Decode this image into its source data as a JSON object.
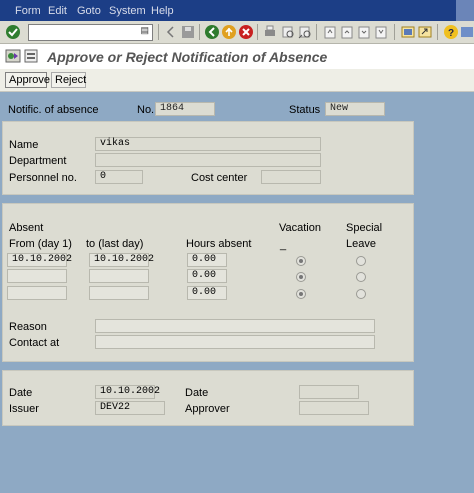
{
  "menu": [
    "Form",
    "Edit",
    "Goto",
    "System",
    "Help"
  ],
  "page_title": "Approve or Reject Notification of Absence",
  "actions": {
    "approve": "Approve",
    "reject": "Reject"
  },
  "header": {
    "notific_label": "Notific. of absence",
    "no_label": "No.",
    "no_value": "1864",
    "status_label": "Status",
    "status_value": "New"
  },
  "employee": {
    "name_label": "Name",
    "name_value": "vikas",
    "department_label": "Department",
    "department_value": "",
    "personnel_label": "Personnel no.",
    "personnel_value": "0",
    "cost_center_label": "Cost center",
    "cost_center_value": ""
  },
  "absence": {
    "absent_label": "Absent",
    "from_label": "From (day 1)",
    "to_label": "to (last day)",
    "hours_label": "Hours absent",
    "vacation_label": "Vacation",
    "vacation_sub": "_",
    "special_label": "Special",
    "leave_label": "Leave",
    "rows": [
      {
        "from": "10.10.2002",
        "to": "10.10.2002",
        "hours": "0.00",
        "vacation": true,
        "special": false
      },
      {
        "from": "",
        "to": "",
        "hours": "0.00",
        "vacation": true,
        "special": false
      },
      {
        "from": "",
        "to": "",
        "hours": "0.00",
        "vacation": true,
        "special": false
      }
    ],
    "reason_label": "Reason",
    "reason_value": "",
    "contact_label": "Contact at",
    "contact_value": ""
  },
  "footer": {
    "date_label": "Date",
    "date_value": "10.10.2002",
    "issuer_label": "Issuer",
    "issuer_value": "DEV22",
    "date2_label": "Date",
    "date2_value": "",
    "approver_label": "Approver",
    "approver_value": ""
  }
}
